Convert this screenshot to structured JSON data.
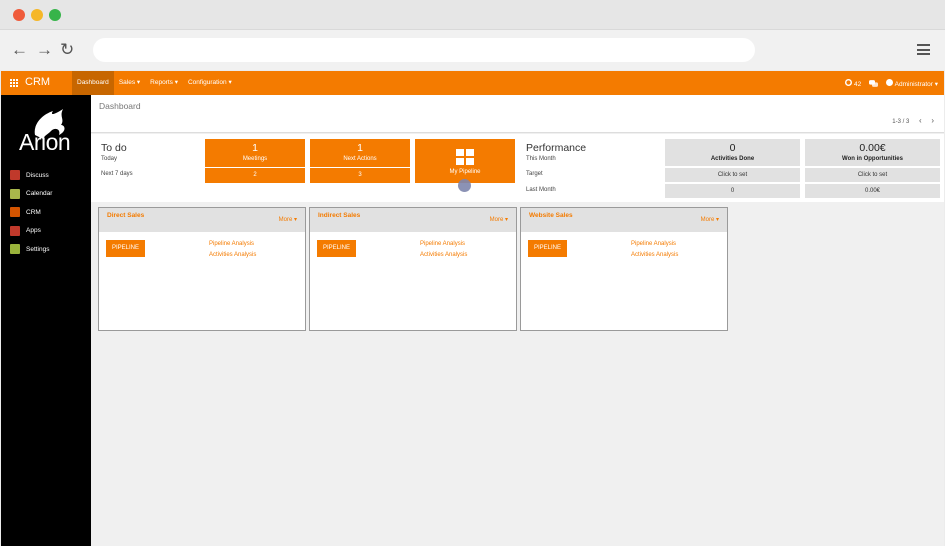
{
  "browser": {
    "address": "",
    "nav": {
      "back": "←",
      "forward": "→",
      "reload": "↻"
    }
  },
  "topbar": {
    "brand": "CRM",
    "menu": [
      "Dashboard",
      "Sales ▾",
      "Reports ▾",
      "Configuration ▾"
    ],
    "badge": "42",
    "user": "Administrator ▾"
  },
  "sidebar": {
    "logo_text": "Arion",
    "items": [
      {
        "label": "Discuss",
        "color": "#c0392b"
      },
      {
        "label": "Calendar",
        "color": "#a8b84b"
      },
      {
        "label": "CRM",
        "color": "#d35400"
      },
      {
        "label": "Apps",
        "color": "#c0392b"
      },
      {
        "label": "Settings",
        "color": "#9ab33b"
      }
    ]
  },
  "dashboard": {
    "title": "Dashboard",
    "pager": "1-3 / 3",
    "todo": {
      "title": "To do",
      "today": "Today",
      "next7": "Next 7 days",
      "meetings": {
        "count": "1",
        "label": "Meetings",
        "next": "2"
      },
      "next_actions": {
        "count": "1",
        "label": "Next Actions",
        "next": "3"
      },
      "pipeline": {
        "label": "My Pipeline"
      }
    },
    "performance": {
      "title": "Performance",
      "this_month": "This Month",
      "target": "Target",
      "last_month": "Last Month",
      "activities": {
        "value": "0",
        "label": "Activities Done",
        "target": "Click to set",
        "last": "0"
      },
      "won": {
        "value": "0.00€",
        "label": "Won in Opportunities",
        "target": "Click to set",
        "last": "0.00€"
      }
    },
    "panels": [
      {
        "title": "Direct Sales",
        "more": "More ▾",
        "button": "PIPELINE",
        "link1": "Pipeline Analysis",
        "link2": "Activities Analysis"
      },
      {
        "title": "Indirect Sales",
        "more": "More ▾",
        "button": "PIPELINE",
        "link1": "Pipeline Analysis",
        "link2": "Activities Analysis"
      },
      {
        "title": "Website Sales",
        "more": "More ▾",
        "button": "PIPELINE",
        "link1": "Pipeline Analysis",
        "link2": "Activities Analysis"
      }
    ]
  }
}
